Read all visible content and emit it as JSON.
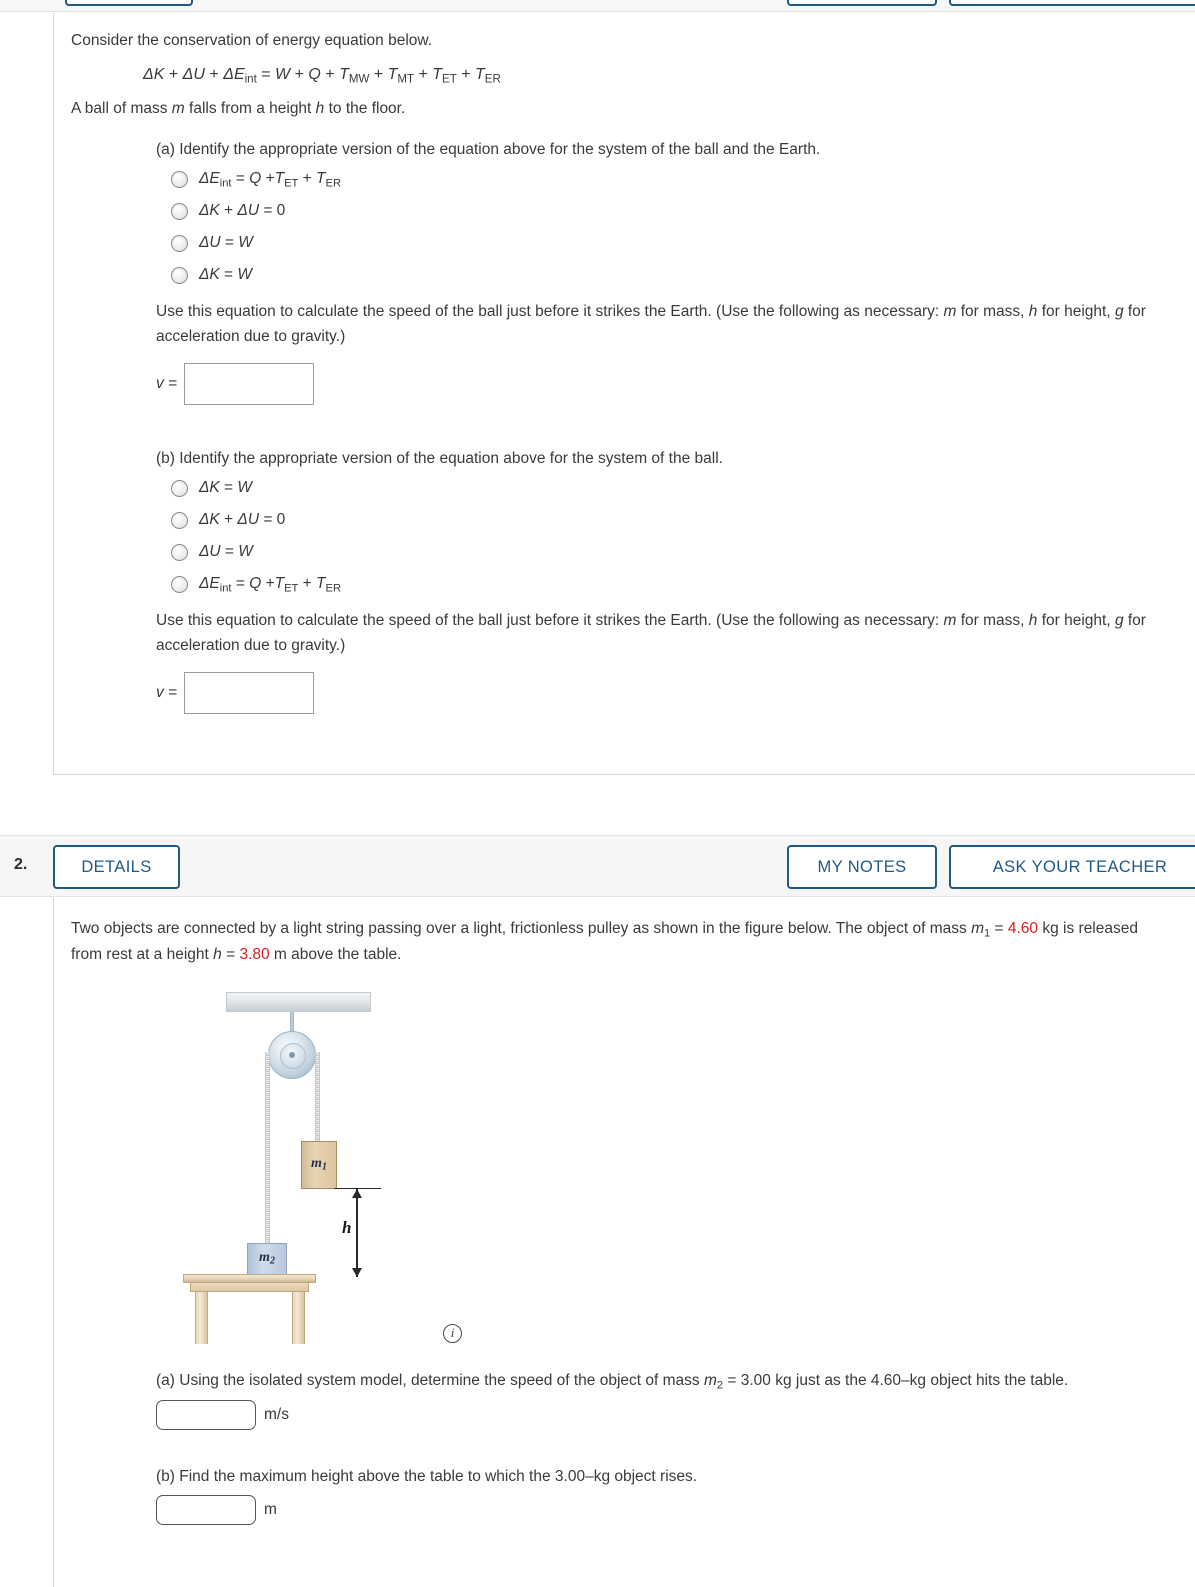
{
  "question1": {
    "intro": "Consider the conservation of energy equation below.",
    "equation": {
      "lhs_dk": "ΔK",
      "plus1": "+",
      "lhs_du": "ΔU",
      "plus2": "+",
      "lhs_de": "ΔE",
      "lhs_de_sub": "int",
      "eq": "=",
      "rhs_w": "W",
      "plus3": "+",
      "rhs_q": "Q",
      "plus4": "+",
      "t_mw": "T",
      "t_mw_sub": "MW",
      "plus5": "+",
      "t_mt": "T",
      "t_mt_sub": "MT",
      "plus6": "+",
      "t_et": "T",
      "t_et_sub": "ET",
      "plus7": "+",
      "t_er": "T",
      "t_er_sub": "ER"
    },
    "setup_pre": "A ball of mass ",
    "setup_m": "m",
    "setup_mid": " falls from a height ",
    "setup_h": "h",
    "setup_post": " to the floor.",
    "part_a": {
      "prompt": "(a) Identify the appropriate version of the equation above for the system of the ball and the Earth.",
      "options": [
        {
          "id": "a-opt-1",
          "text": "ΔEint = Q +TET + TER"
        },
        {
          "id": "a-opt-2",
          "text": "ΔK + ΔU = 0"
        },
        {
          "id": "a-opt-3",
          "text": "ΔU = W"
        },
        {
          "id": "a-opt-4",
          "text": "ΔK = W"
        }
      ],
      "instruction": "Use this equation to calculate the speed of the ball just before it strikes the Earth. (Use the following as necessary: m for mass, h for height, g for acceleration due to gravity.)",
      "answer_label": "v =",
      "answer_value": "",
      "answer_placeholder": ""
    },
    "part_b": {
      "prompt": "(b) Identify the appropriate version of the equation above for the system of the ball.",
      "options": [
        {
          "id": "b-opt-1",
          "text": "ΔK = W"
        },
        {
          "id": "b-opt-2",
          "text": "ΔK + ΔU = 0"
        },
        {
          "id": "b-opt-3",
          "text": "ΔU = W"
        },
        {
          "id": "b-opt-4",
          "text": "ΔEint = Q +TET + TER"
        }
      ],
      "instruction": "Use this equation to calculate the speed of the ball just before it strikes the Earth. (Use the following as necessary: m for mass, h for height, g for acceleration due to gravity.)",
      "answer_label": "v =",
      "answer_value": "",
      "answer_placeholder": ""
    }
  },
  "question2": {
    "number": "2.",
    "buttons": {
      "details": "DETAILS",
      "my_notes": "MY NOTES",
      "ask_teacher": "ASK YOUR TEACHER"
    },
    "stem": {
      "s1": "Two objects are connected by a light string passing over a light, frictionless pulley as shown in the figure below. The object of mass ",
      "m1": "m",
      "m1_sub": "1",
      "s2": " = ",
      "mass_value": "4.60",
      "s3": " kg is released from rest at a height ",
      "h": "h",
      "s4": " = ",
      "height_value": "3.80",
      "s5": " m above the table."
    },
    "figure": {
      "label_m1": "m",
      "label_m1_sub": "1",
      "label_m2": "m",
      "label_m2_sub": "2",
      "label_h": "h",
      "info": "i"
    },
    "part_a": {
      "text_pre": "(a) Using the isolated system model, determine the speed of the object of mass ",
      "m2": "m",
      "m2_sub": "2",
      "text_mid": " = 3.00 kg just as the 4.60–kg object hits the table.",
      "answer_value": "",
      "unit": "m/s"
    },
    "part_b": {
      "text": "(b) Find the maximum height above the table to which the 3.00–kg object rises.",
      "answer_value": "",
      "unit": "m"
    }
  },
  "colors": {
    "accent_blue": "#1f5a86",
    "red_value": "#d81f1f",
    "header_bg": "#f6f6f6",
    "text": "#3a3a3a"
  }
}
